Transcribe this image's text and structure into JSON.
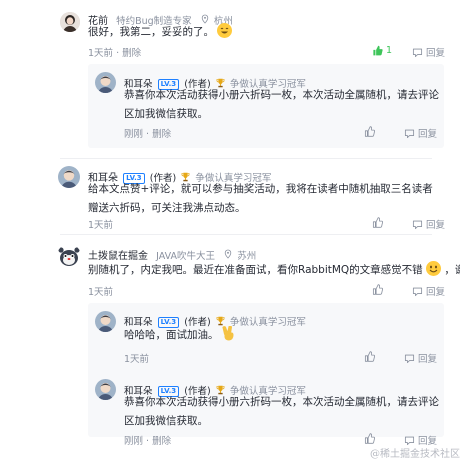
{
  "comments": [
    {
      "author": "花前",
      "job": "特约Bug制造专家",
      "location": "杭州",
      "text": "很好，我第二，妥妥的了。",
      "time": "1天前",
      "delete": "删除",
      "likes": "1",
      "reply": "回复",
      "replies": [
        {
          "author": "和耳朵",
          "level": "LV.3",
          "author_tag": "(作者)",
          "badge": "争做认真学习冠军",
          "text": "恭喜你本次活动获得小册六折码一枚，本次活动全属随机，请去评论区加我微信获取。",
          "time": "刚刚",
          "delete": "删除",
          "reply": "回复"
        }
      ]
    },
    {
      "author": "和耳朵",
      "level": "LV.3",
      "author_tag": "(作者)",
      "badge": "争做认真学习冠军",
      "text": "给本文点赞+评论，就可以参与抽奖活动，我将在读者中随机抽取三名读者赠送六折码，可关注我沸点动态。",
      "time": "1天前",
      "reply": "回复"
    },
    {
      "author": "土拨鼠在掘金",
      "job": "JAVA吹牛大王",
      "location": "苏州",
      "text": "别随机了，内定我吧。最近在准备面试，看你RabbitMQ的文章感觉不错",
      "text_tail": "，谢谢",
      "time": "1天前",
      "reply": "回复",
      "replies": [
        {
          "author": "和耳朵",
          "level": "LV.3",
          "author_tag": "(作者)",
          "badge": "争做认真学习冠军",
          "text": "哈哈哈，面试加油。",
          "time": "1天前",
          "reply": "回复"
        },
        {
          "author": "和耳朵",
          "level": "LV.3",
          "author_tag": "(作者)",
          "badge": "争做认真学习冠军",
          "text": "恭喜你本次活动获得小册六折码一枚，本次活动全属随机，请去评论区加我微信获取。",
          "time": "刚刚",
          "delete": "删除",
          "reply": "回复"
        }
      ]
    }
  ],
  "watermark": "@稀土掘金技术社区",
  "colors": {
    "accent": "#1e80ff",
    "liked": "#3ec55a",
    "muted": "#8a919f",
    "reply_bg": "#f7f8fa"
  }
}
